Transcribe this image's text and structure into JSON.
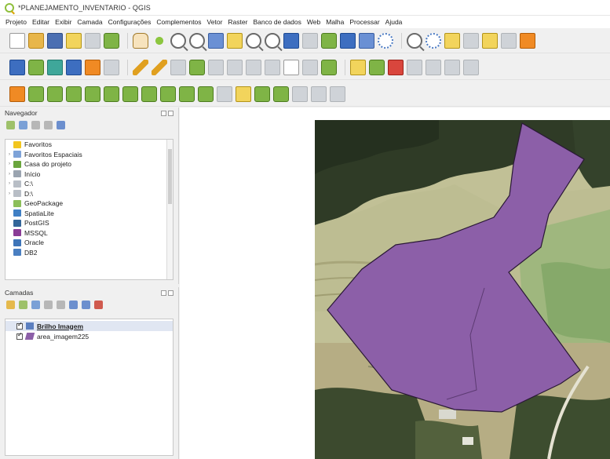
{
  "window": {
    "title": "*PLANEJAMENTO_INVENTARIO - QGIS"
  },
  "menu": [
    "Projeto",
    "Editar",
    "Exibir",
    "Camada",
    "Configurações",
    "Complementos",
    "Vetor",
    "Raster",
    "Banco de dados",
    "Web",
    "Malha",
    "Processar",
    "Ajuda"
  ],
  "navigator": {
    "title": "Navegador",
    "items": [
      {
        "label": "Favoritos",
        "icon": "star-icon",
        "color": "#f2c61f",
        "expand": ""
      },
      {
        "label": "Favoritos Espaciais",
        "icon": "spatial-bookmark-icon",
        "color": "#7ea3d8",
        "expand": "›"
      },
      {
        "label": "Casa do projeto",
        "icon": "project-home-icon",
        "color": "#6aa53d",
        "expand": "›"
      },
      {
        "label": "Início",
        "icon": "home-folder-icon",
        "color": "#9aa4b0",
        "expand": "›"
      },
      {
        "label": "C:\\",
        "icon": "drive-icon",
        "color": "#b8bec6",
        "expand": "›"
      },
      {
        "label": "D:\\",
        "icon": "drive-icon",
        "color": "#b8bec6",
        "expand": "›"
      },
      {
        "label": "GeoPackage",
        "icon": "geopackage-icon",
        "color": "#8cbf5a",
        "expand": ""
      },
      {
        "label": "SpatiaLite",
        "icon": "spatialite-icon",
        "color": "#3f7fc4",
        "expand": ""
      },
      {
        "label": "PostGIS",
        "icon": "postgis-icon",
        "color": "#336699",
        "expand": ""
      },
      {
        "label": "MSSQL",
        "icon": "mssql-icon",
        "color": "#8a3c96",
        "expand": ""
      },
      {
        "label": "Oracle",
        "icon": "oracle-icon",
        "color": "#3d74b8",
        "expand": ""
      },
      {
        "label": "DB2",
        "icon": "db2-icon",
        "color": "#4a7fc1",
        "expand": ""
      }
    ]
  },
  "layers": {
    "title": "Camadas",
    "items": [
      {
        "label": "Brilho Imagem",
        "icon": "raster-layer-icon",
        "color": "#5b7fc0",
        "selected": true
      },
      {
        "label": "area_imagem225",
        "icon": "polygon-layer-icon",
        "color": "#8c5fa8",
        "selected": false
      }
    ]
  },
  "map": {
    "polygon_fill": "#8c5fa8",
    "polygon_stroke": "#2a1836"
  }
}
